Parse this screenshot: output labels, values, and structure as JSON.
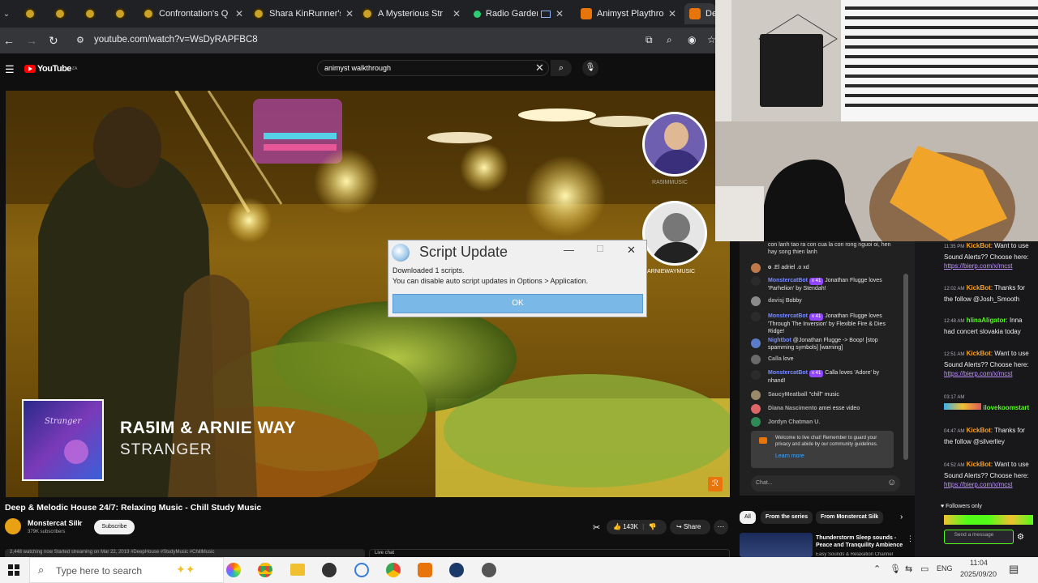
{
  "browser": {
    "tabs": [
      {
        "label": ""
      },
      {
        "label": ""
      },
      {
        "label": ""
      },
      {
        "label": ""
      },
      {
        "label": "Confrontation's Q"
      },
      {
        "label": "Shara KinRunner's"
      },
      {
        "label": "A Mysterious Stra"
      },
      {
        "label": "Radio Garden"
      },
      {
        "label": "Animyst Playthrou"
      },
      {
        "label": "De"
      }
    ],
    "url": "youtube.com/watch?v=WsDyRAPFBC8"
  },
  "youtube": {
    "logo_text": "YouTube",
    "logo_region": "ZA",
    "search_value": "animyst walkthrough",
    "video": {
      "artist": "RA5IM & ARNIE WAY",
      "track": "STRANGER",
      "album_text": "Stranger",
      "avatar1_label": "RA5IMMUSIC",
      "avatar2_label": "ARNIEWAYMUSIC"
    },
    "title": "Deep & Melodic House 24/7: Relaxing Music - Chill Study Music",
    "channel": "Monstercat Silk",
    "subscribers": "379K subscribers",
    "subscribe_label": "Subscribe",
    "likes": "143K",
    "share_label": "Share",
    "description_snippet": "2,448 watching now  Started streaming on Mar 22, 2019  #DeepHouse #StudyMusic #ChillMusic",
    "live_chat_label": "Live chat",
    "chips": [
      "All",
      "From the series",
      "From Monstercat Silk"
    ],
    "related_title": "Thunderstorm Sleep sounds - Peace and Tranquility Ambience",
    "related_channel": "Easy Sounds & Relaxation Channel"
  },
  "dialog": {
    "title": "Script Update",
    "line1": "Downloaded 1 scripts.",
    "line2": "You can disable auto script updates in Options > Application.",
    "ok_label": "OK"
  },
  "yt_chat": {
    "top_text": "con lanh tao ra con cua la con rong nguoi oi, hen hay song thien lanh",
    "messages": [
      {
        "name": "o",
        "text": ".El adriel .o xd",
        "color": "#c07a4a"
      },
      {
        "name": "MonstercatBot",
        "text": "Jonathan Flugge loves 'Parhelion' by Stendah!",
        "badge": "x 41",
        "color": "#2b2b2b"
      },
      {
        "name": "davisj",
        "text": "Bobby",
        "color": "#8a8a8a"
      },
      {
        "name": "MonstercatBot",
        "text": "Jonathan Flugge loves 'Through The Inversion' by Flexible Fire & Dies Ridge!",
        "badge": "x 41",
        "color": "#2b2b2b"
      },
      {
        "name": "Nightbot",
        "text": "@Jonathan Flugge -> Boop! [stop spamming symbols] [warning]",
        "color": "#5a7cc9"
      },
      {
        "name": "Calla",
        "text": "love",
        "color": "#6a6a6a"
      },
      {
        "name": "MonstercatBot",
        "text": "Calla loves 'Adore' by nhand!",
        "badge": "x 41",
        "color": "#2b2b2b"
      },
      {
        "name": "SaucyMeatball",
        "text": "\"chill\" music",
        "color": "#9a8a6a"
      },
      {
        "name": "Diana Nascimento",
        "text": "amei esse video",
        "color": "#d66"
      },
      {
        "name": "Jordyn Chatman",
        "text": "U.",
        "color": "#2e8b57"
      }
    ],
    "welcome": "Welcome to live chat! Remember to guard your privacy and abide by our community guidelines.",
    "learn_more": "Learn more",
    "input_placeholder": "Chat..."
  },
  "stream_chat": {
    "messages": [
      {
        "time": "11:35 PM",
        "name": "KickBot",
        "text": "Want to use Sound Alerts?? Choose here:",
        "link": "https://bierp.com/x/mcst"
      },
      {
        "time": "12:02 AM",
        "name": "KickBot",
        "text": "Thanks for the follow @Josh_Smooth",
        "link": ""
      },
      {
        "time": "12:48 AM",
        "name": "hlinaAligator",
        "text": "Inna had concert slovakia today",
        "link": ""
      },
      {
        "time": "12:51 AM",
        "name": "KickBot",
        "text": "Want to use Sound Alerts?? Choose here:",
        "link": "https://bierp.com/x/mcst"
      },
      {
        "time": "03:17 AM",
        "name": "ilovekoomstart",
        "text": "",
        "link": ""
      },
      {
        "time": "04:47 AM",
        "name": "KickBot",
        "text": "Thanks for the follow @silverlley",
        "link": ""
      },
      {
        "time": "04:52 AM",
        "name": "KickBot",
        "text": "Want to use Sound Alerts?? Choose here:",
        "link": "https://bierp.com/x/mcst"
      }
    ],
    "followers_only": "Followers only",
    "send_label": "Send a message"
  },
  "taskbar": {
    "search_placeholder": "Type here to search",
    "language": "ENG",
    "time": "11:04",
    "date": "2025/09/20"
  },
  "colors": {
    "yt_red": "#ff0000",
    "kick_green": "#53fc18",
    "dialog_ok": "#7ab8e8"
  }
}
